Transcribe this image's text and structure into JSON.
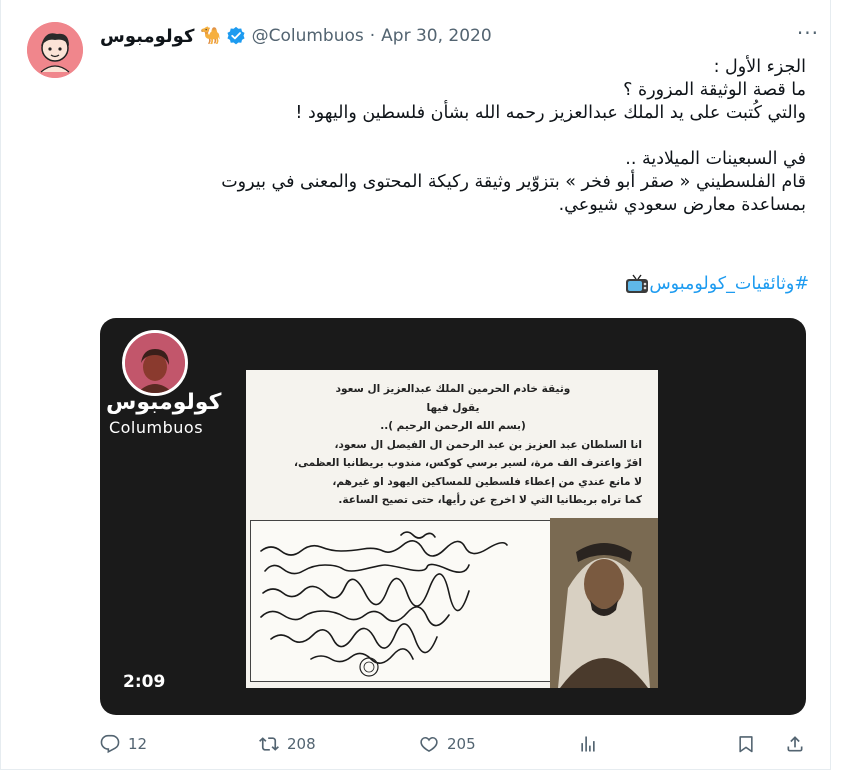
{
  "author": {
    "name": "كولومبوس",
    "emoji": "🐪",
    "handle": "@Columbuos",
    "dot": "·",
    "date": "Apr 30, 2020"
  },
  "tweet": {
    "lines": [
      "الجزء الأول :",
      "ما قصة الوثيقة المزورة ؟",
      "والتي كُتبت على يد الملك عبدالعزيز رحمه الله بشأن فلسطين واليهود !",
      "",
      "في السبعينات الميلادية ..",
      "قام الفلسطيني « صقر أبو فخر » بتزوّير وثيقة ركيكة المحتوى والمعنى في بيروت",
      "بمساعدة معارض سعودي شيوعي."
    ],
    "hashtag": "#وثائقيات_كولومبوس"
  },
  "video": {
    "channel_name_ar": "كولومبوس",
    "channel_name_en": "Columbuos",
    "duration": "2:09",
    "document_lines": [
      "وثيقة خادم الحرمين الملك عبدالعزيز ال سعود",
      "يقول فيها",
      "(بسم الله الرحمن الرحيم )..",
      "انا السلطان عبد العزيز بن عبد الرحمن ال الفيصل ال سعود،",
      "اقرّ واعترف الف مرة، لسير برسي كوكس، مندوب بريطانيا العظمى،",
      "لا مانع عندي من إعطاء فلسطين للمساكين اليهود او غيرهم،",
      "كما تراه بريطانيا التي لا اخرج عن رأيها، حتى تصيح الساعة."
    ]
  },
  "actions": {
    "replies": "12",
    "retweets": "208",
    "likes": "205"
  },
  "colors": {
    "accent": "#1d9bf0",
    "muted": "#536471",
    "text": "#0f1419"
  }
}
